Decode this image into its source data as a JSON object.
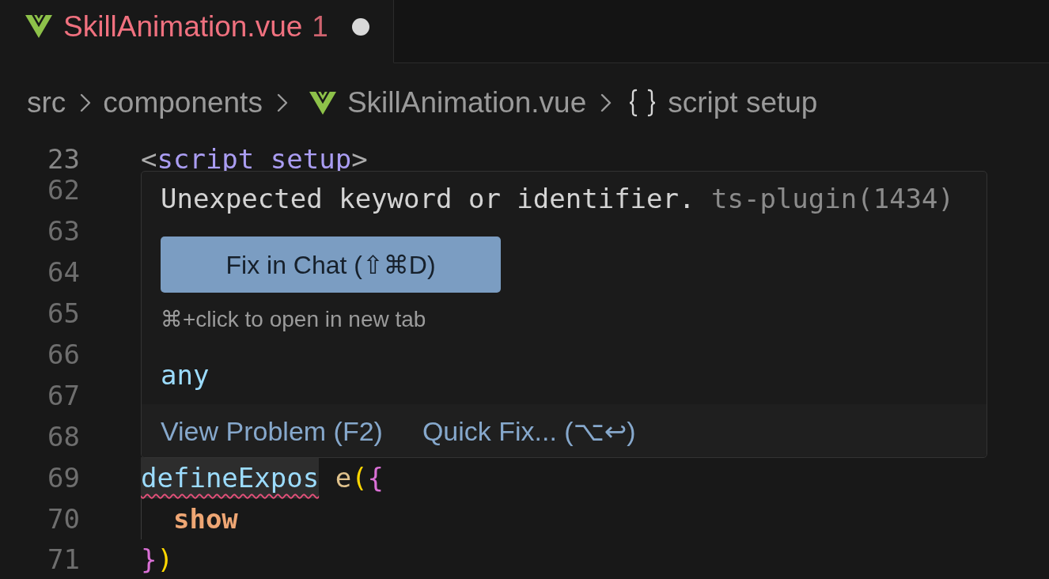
{
  "tabs": [
    {
      "label": "SkillAnimation.vue",
      "has_errors": true,
      "problems": "1",
      "modified": true,
      "selected": true
    }
  ],
  "breadcrumb": [
    {
      "kind": "folder",
      "label": "src"
    },
    {
      "kind": "folder",
      "label": "components"
    },
    {
      "kind": "vue",
      "label": "SkillAnimation.vue"
    },
    {
      "kind": "symbol",
      "label": "script setup"
    }
  ],
  "editor": {
    "sticky_lines": [
      {
        "number": "23",
        "tokens": [
          {
            "text": "<",
            "kind": "punct"
          },
          {
            "text": "script setup",
            "kind": "tag"
          },
          {
            "text": ">",
            "kind": "punct"
          }
        ]
      }
    ],
    "lines": [
      {
        "number": "62"
      },
      {
        "number": "63"
      },
      {
        "number": "64"
      },
      {
        "number": "65"
      },
      {
        "number": "66"
      },
      {
        "number": "67"
      },
      {
        "number": "68"
      },
      {
        "number": "69",
        "tokens": [
          {
            "text": "defineExpos",
            "kind": "variable",
            "error": true,
            "highlighted": true
          },
          {
            "text": "e",
            "kind": "function",
            "space_before": true
          },
          {
            "text": "(",
            "kind": "paren"
          },
          {
            "text": "{",
            "kind": "brace"
          }
        ]
      },
      {
        "number": "70",
        "indented": true,
        "tokens": [
          {
            "text": "show",
            "kind": "property"
          }
        ]
      },
      {
        "number": "71",
        "tokens": [
          {
            "text": "}",
            "kind": "brace"
          },
          {
            "text": ")",
            "kind": "paren"
          }
        ]
      }
    ]
  },
  "hover": {
    "message": "Unexpected keyword or identifier.",
    "source": "ts-plugin(1434)",
    "action_button": "Fix in Chat (⇧⌘D)",
    "hint": "⌘+click to open in new tab",
    "type": "any",
    "actions": [
      "View Problem (F2)",
      "Quick Fix... (⌥↩)"
    ]
  }
}
